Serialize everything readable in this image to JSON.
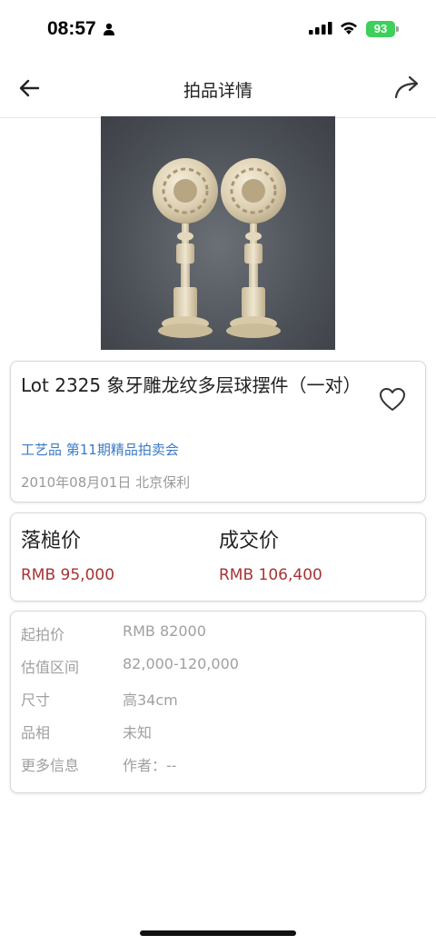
{
  "status_bar": {
    "time": "08:57",
    "battery": "93"
  },
  "nav": {
    "title": "拍品详情"
  },
  "lot": {
    "title": "Lot 2325 象牙雕龙纹多层球摆件（一对）",
    "category": "工艺品 第11期精品拍卖会",
    "date_house": "2010年08月01日 北京保利"
  },
  "prices": {
    "hammer_label": "落槌价",
    "hammer_value": "RMB 95,000",
    "deal_label": "成交价",
    "deal_value": "RMB 106,400"
  },
  "details": [
    {
      "key": "起拍价",
      "value": "RMB 82000"
    },
    {
      "key": "估值区间",
      "value": "82,000-120,000"
    },
    {
      "key": "尺寸",
      "value": "高34cm"
    },
    {
      "key": "品相",
      "value": "未知"
    },
    {
      "key": "更多信息",
      "value": "作者：--"
    }
  ],
  "icons": {
    "back": "back-arrow-icon",
    "share": "share-icon",
    "favorite": "heart-icon"
  },
  "colors": {
    "price": "#a63434",
    "link": "#3c7bc4",
    "battery": "#3ecf5c"
  }
}
